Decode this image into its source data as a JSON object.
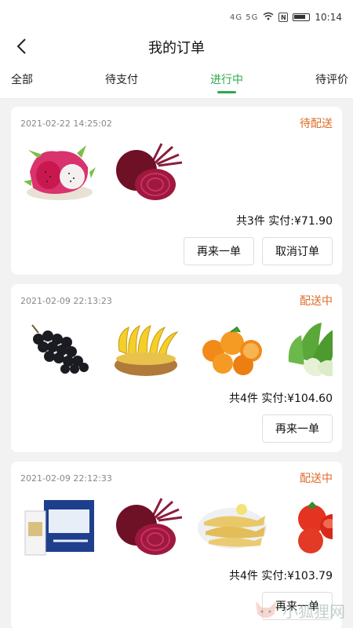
{
  "statusbar": {
    "signal": "4G 5G",
    "time": "10:14"
  },
  "header": {
    "title": "我的订单"
  },
  "tabs": [
    {
      "label": "全部"
    },
    {
      "label": "待支付"
    },
    {
      "label": "进行中"
    },
    {
      "label": "待评价"
    }
  ],
  "orders": [
    {
      "time": "2021-02-22 14:25:02",
      "status": "待配送",
      "total": "共3件  实付:¥71.90",
      "items": [
        "dragon-fruit",
        "beetroot"
      ],
      "buttons": [
        "再来一单",
        "取消订单"
      ]
    },
    {
      "time": "2021-02-09 22:13:23",
      "status": "配送中",
      "total": "共4件  实付:¥104.60",
      "items": [
        "grapes",
        "bananas",
        "oranges",
        "bok-choy"
      ],
      "buttons": [
        "再来一单"
      ]
    },
    {
      "time": "2021-02-09 22:12:33",
      "status": "配送中",
      "total": "共4件  实付:¥103.79",
      "items": [
        "milk-box",
        "beetroot",
        "yellow-croaker-fish",
        "tomatoes"
      ],
      "buttons": [
        "再来一单"
      ]
    }
  ],
  "watermark": {
    "text": "小狐狸网"
  },
  "colors": {
    "accent": "#2fa84f",
    "status": "#e06b28"
  }
}
